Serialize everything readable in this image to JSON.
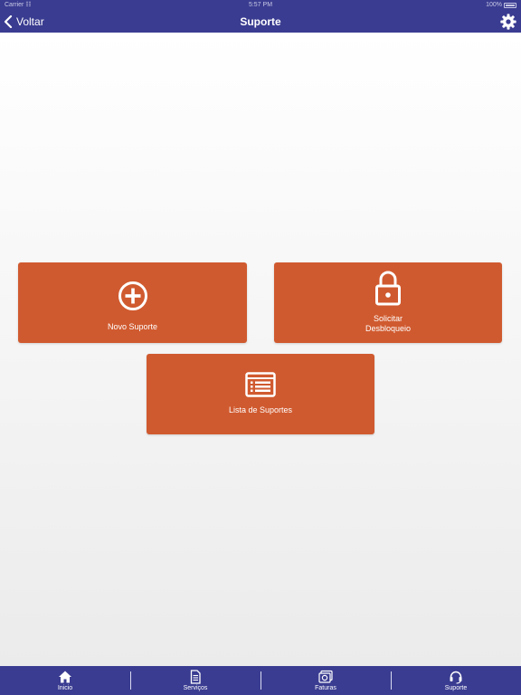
{
  "status_bar": {
    "carrier": "Carrier",
    "time": "5:57 PM",
    "battery": "100%"
  },
  "nav": {
    "back_label": "Voltar",
    "title": "Suporte",
    "settings_icon": "gear-icon"
  },
  "tiles": [
    {
      "label": "Novo Suporte",
      "icon": "plus-circle-icon"
    },
    {
      "label_line1": "Solicitar",
      "label_line2": "Desbloqueio",
      "icon": "unlock-icon"
    },
    {
      "label": "Lista de Suportes",
      "icon": "list-icon"
    }
  ],
  "tab_bar": {
    "items": [
      {
        "label": "Inicio",
        "icon": "home-icon"
      },
      {
        "label": "Serviços",
        "icon": "document-icon"
      },
      {
        "label": "Faturas",
        "icon": "money-icon"
      },
      {
        "label": "Suporte",
        "icon": "headset-icon"
      }
    ]
  },
  "colors": {
    "primary": "#3a3c91",
    "tile": "#d05a2f",
    "background": "#ffffff"
  }
}
